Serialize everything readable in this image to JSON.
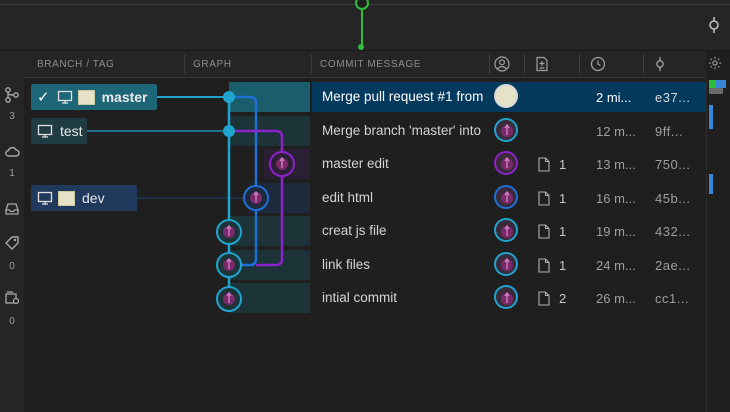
{
  "header": {
    "columns": [
      "BRANCH / TAG",
      "GRAPH",
      "COMMIT MESSAGE"
    ]
  },
  "left_rail": [
    {
      "icon": "branch-icon",
      "count": "3"
    },
    {
      "icon": "cloud-icon",
      "count": "1"
    },
    {
      "icon": "inbox-icon",
      "count": ""
    },
    {
      "icon": "tag-icon",
      "count": "0"
    },
    {
      "icon": "worktree-icon",
      "count": "0"
    }
  ],
  "refs": [
    {
      "label": "master",
      "check": "✓"
    },
    {
      "label": "test"
    },
    {
      "label": "dev"
    }
  ],
  "commits": [
    {
      "message": "Merge pull request #1 from",
      "files": "",
      "date": "2 mi...",
      "sha": "e37..."
    },
    {
      "message": "Merge branch 'master' into",
      "files": "",
      "date": "12 m...",
      "sha": "9ff..."
    },
    {
      "message": "master edit",
      "files": "1",
      "date": "13 m...",
      "sha": "750..."
    },
    {
      "message": "edit html",
      "files": "1",
      "date": "16 m...",
      "sha": "45b..."
    },
    {
      "message": "creat js file",
      "files": "1",
      "date": "19 m...",
      "sha": "432..."
    },
    {
      "message": "link files",
      "files": "1",
      "date": "24 m...",
      "sha": "2ae..."
    },
    {
      "message": "intial commit",
      "files": "2",
      "date": "26 m...",
      "sha": "cc1..."
    }
  ],
  "colors": {
    "lane_cyan": "#1fa3cf",
    "lane_blue": "#1f6fd6",
    "lane_purple": "#8c22c9",
    "selected_row": "#04395e",
    "ref_master": "#1d6677",
    "ref_test": "#203c43",
    "ref_dev": "#1f3a5c",
    "fetch_green": "#2dbd3a"
  }
}
